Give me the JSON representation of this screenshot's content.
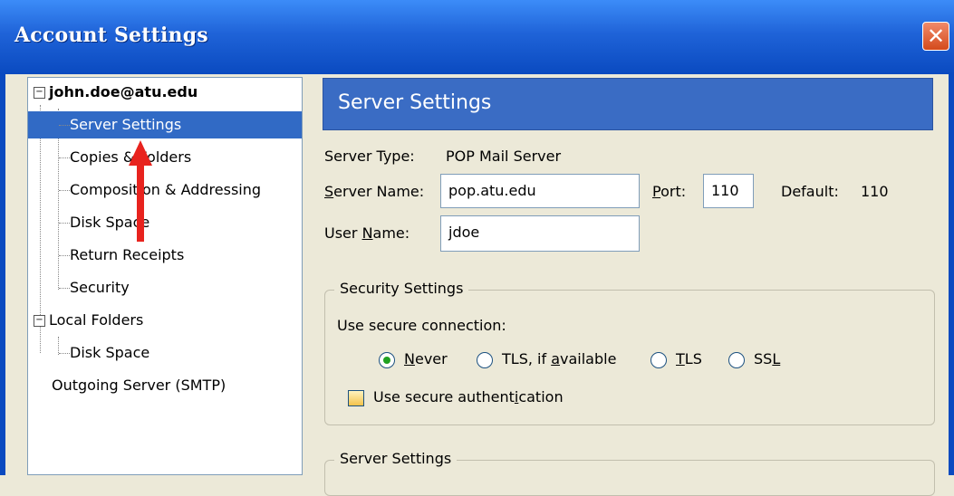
{
  "window": {
    "title": "Account Settings",
    "close_glyph": "✕"
  },
  "tree": {
    "account": "john.doe@atu.edu",
    "account_children": [
      "Server Settings",
      "Copies & Folders",
      "Composition & Addressing",
      "Disk Space",
      "Return Receipts",
      "Security"
    ],
    "local_folders": "Local Folders",
    "local_children": [
      "Disk Space"
    ],
    "outgoing": "Outgoing Server (SMTP)",
    "selected": "Server Settings",
    "toggle_glyph": "−"
  },
  "panel": {
    "header": "Server Settings",
    "server_type_label": "Server Type:",
    "server_type_value": "POP Mail Server",
    "server_name_label_prefix": "S",
    "server_name_label_rest": "erver Name:",
    "server_name_value": "pop.atu.edu",
    "port_label_prefix": "P",
    "port_label_rest": "ort:",
    "port_value": "110",
    "default_label": "Default:",
    "default_value": "110",
    "user_name_label_prefix": "User ",
    "user_name_label_u": "N",
    "user_name_label_rest": "ame:",
    "user_name_value": "jdoe"
  },
  "security": {
    "legend": "Security Settings",
    "connection_label": "Use secure connection:",
    "options": [
      {
        "pre": "",
        "u": "N",
        "post": "ever",
        "checked": true
      },
      {
        "pre": "TLS, if ",
        "u": "a",
        "post": "vailable",
        "checked": false
      },
      {
        "pre": "",
        "u": "T",
        "post": "LS",
        "checked": false
      },
      {
        "pre": "SS",
        "u": "L",
        "post": "",
        "checked": false
      }
    ],
    "auth_pre": "Use secure authent",
    "auth_u": "i",
    "auth_post": "cation"
  },
  "server_group": {
    "legend": "Server Settings"
  },
  "annotation": {
    "arrow_color": "#e8231e"
  }
}
